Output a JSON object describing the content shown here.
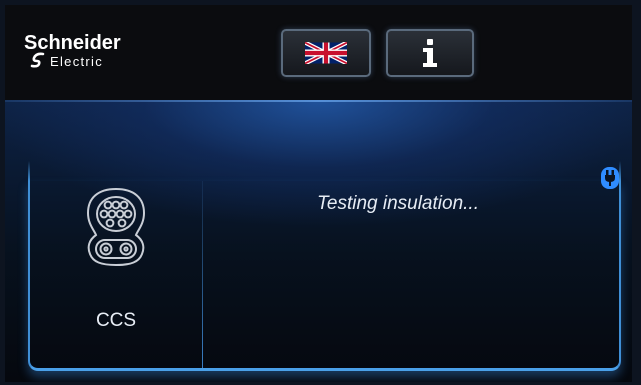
{
  "header": {
    "brand_name": "Schneider",
    "brand_sub": "Electric",
    "language_flag": "uk-flag-icon",
    "info_glyph": "i"
  },
  "connector": {
    "label": "CCS",
    "icon": "ccs-connector-icon"
  },
  "status": {
    "message": "Testing insulation...",
    "plug_status_icon": "plug-icon"
  },
  "colors": {
    "accent_blue": "#3f8fd6",
    "status_icon_blue": "#2f8cff",
    "header_bg": "#0b0c0f"
  }
}
